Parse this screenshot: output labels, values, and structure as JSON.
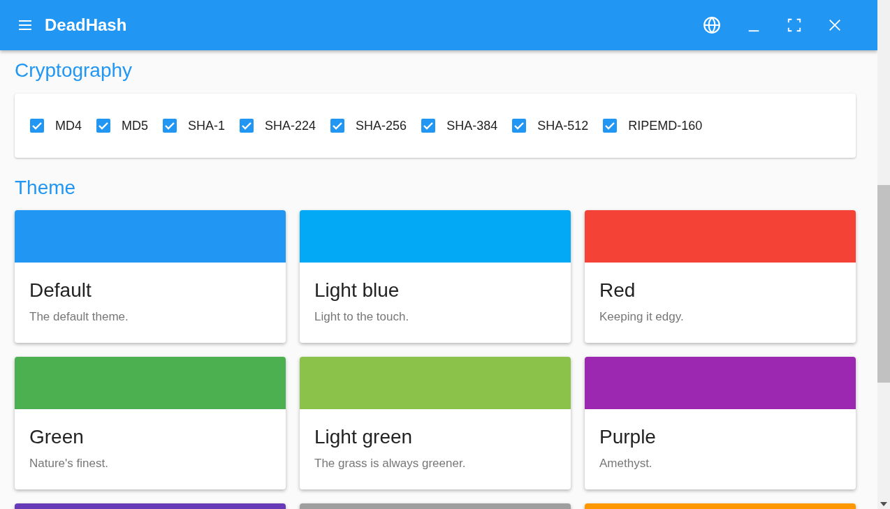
{
  "app_bar": {
    "title": "DeadHash"
  },
  "cryptography": {
    "heading": "Cryptography",
    "algorithms": [
      {
        "label": "MD4",
        "checked": true
      },
      {
        "label": "MD5",
        "checked": true
      },
      {
        "label": "SHA-1",
        "checked": true
      },
      {
        "label": "SHA-224",
        "checked": true
      },
      {
        "label": "SHA-256",
        "checked": true
      },
      {
        "label": "SHA-384",
        "checked": true
      },
      {
        "label": "SHA-512",
        "checked": true
      },
      {
        "label": "RIPEMD-160",
        "checked": true
      }
    ]
  },
  "theme": {
    "heading": "Theme",
    "themes": [
      {
        "name": "Default",
        "description": "The default theme.",
        "color": "#2196f3"
      },
      {
        "name": "Light blue",
        "description": "Light to the touch.",
        "color": "#03a9f4"
      },
      {
        "name": "Red",
        "description": "Keeping it edgy.",
        "color": "#f44336"
      },
      {
        "name": "Green",
        "description": "Nature's finest.",
        "color": "#4caf50"
      },
      {
        "name": "Light green",
        "description": "The grass is always greener.",
        "color": "#8bc34a"
      },
      {
        "name": "Purple",
        "description": "Amethyst.",
        "color": "#9c27b0"
      },
      {
        "color": "#673ab7"
      },
      {
        "color": "#9e9e9e"
      },
      {
        "color": "#ff9800"
      }
    ]
  }
}
